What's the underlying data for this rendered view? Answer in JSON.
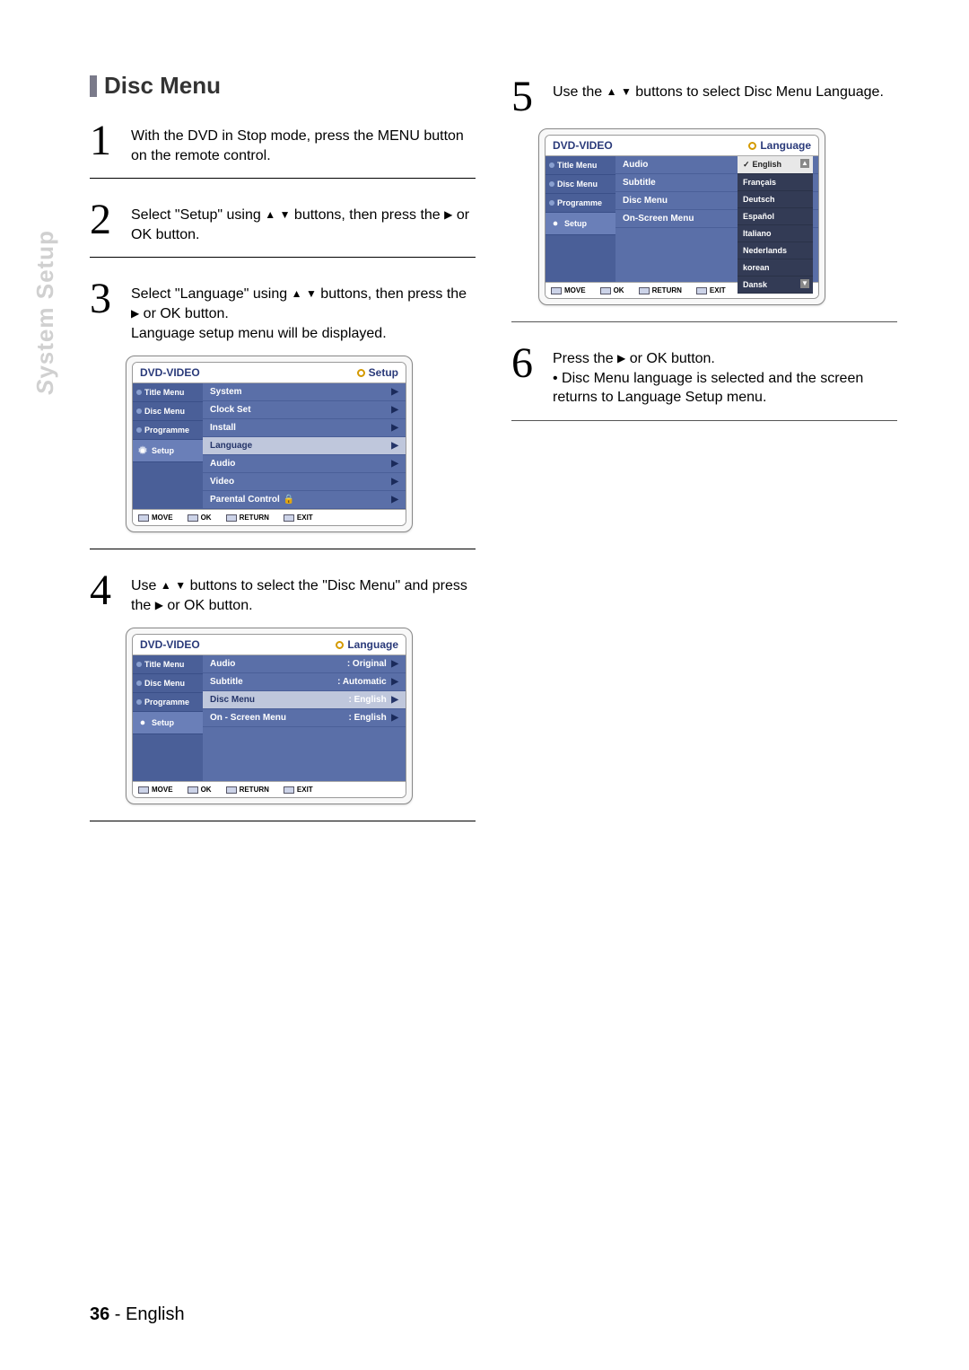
{
  "page": {
    "section_label": "System Setup",
    "title": "Disc Menu",
    "number": "36",
    "lang": "English"
  },
  "steps": {
    "s1": {
      "num": "1",
      "text": "With the DVD in Stop mode, press the MENU button on the remote control."
    },
    "s2": {
      "num": "2",
      "text_a": "Select \"Setup\" using ",
      "text_b": " buttons, then press the ",
      "text_c": " or OK button."
    },
    "s3": {
      "num": "3",
      "text_a": "Select \"Language\" using ",
      "text_b": " buttons, then press the ",
      "text_c": " or OK button.",
      "text_d": "Language setup menu will be displayed."
    },
    "s4": {
      "num": "4",
      "text_a": "Use ",
      "text_b": " buttons to select the \"Disc Menu\" and press the ",
      "text_c": " or OK button."
    },
    "s5": {
      "num": "5",
      "text_a": "Use the ",
      "text_b": " buttons to select Disc Menu Language."
    },
    "s6": {
      "num": "6",
      "text_a": "Press the  ",
      "text_b": " or OK button.",
      "bullet": "Disc Menu language is selected and the screen returns to Language Setup menu."
    }
  },
  "osd_common": {
    "device": "DVD-VIDEO",
    "side": [
      "Title Menu",
      "Disc Menu",
      "Programme",
      "Setup"
    ],
    "footer": [
      "MOVE",
      "OK",
      "RETURN",
      "EXIT"
    ]
  },
  "osd3": {
    "crumb": "Setup",
    "rows": [
      "System",
      "Clock Set",
      "Install",
      "Language",
      "Audio",
      "Video",
      "Parental Control"
    ],
    "selected": 3
  },
  "osd4": {
    "crumb": "Language",
    "rows": [
      {
        "label": "Audio",
        "val": ": Original"
      },
      {
        "label": "Subtitle",
        "val": ": Automatic"
      },
      {
        "label": "Disc Menu",
        "val": ": English"
      },
      {
        "label": "On - Screen Menu",
        "val": ": English"
      }
    ],
    "selected": 2
  },
  "osd5": {
    "crumb": "Language",
    "left_rows": [
      "Audio",
      "Subtitle",
      "Disc Menu",
      "On-Screen Menu"
    ],
    "langs": [
      "English",
      "Français",
      "Deutsch",
      "Español",
      "Italiano",
      "Nederlands",
      "korean",
      "Dansk"
    ],
    "selected": 0
  }
}
